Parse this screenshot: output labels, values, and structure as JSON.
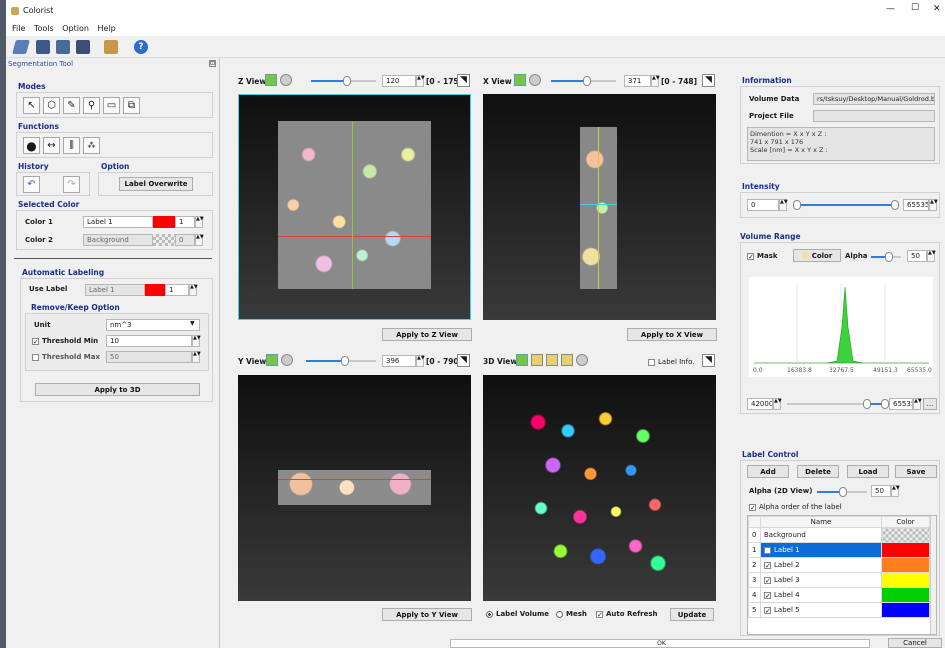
{
  "window": {
    "title": "Colorist",
    "controls": [
      "—",
      "☐",
      "✕"
    ]
  },
  "menu": [
    "File",
    "Tools",
    "Option",
    "Help"
  ],
  "left": {
    "panel_title": "Segmentation Tool",
    "modes_header": "Modes",
    "functions_header": "Functions",
    "history_header": "History",
    "option_header": "Option",
    "label_overwrite": "Label Overwrite",
    "selected_color_header": "Selected Color",
    "color1_label": "Color 1",
    "color1_value": "Label 1",
    "color1_num": "1",
    "color2_label": "Color 2",
    "color2_value": "Background",
    "color2_num": "0",
    "auto_header": "Automatic Labeling",
    "use_label": "Use Label",
    "use_label_value": "Label 1",
    "use_label_num": "1",
    "remove_keep": "Remove/Keep Option",
    "unit_label": "Unit",
    "unit_value": "nm^3",
    "thr_min_label": "Threshold Min",
    "thr_min_value": "10",
    "thr_max_label": "Threshold Max",
    "thr_max_value": "50",
    "apply_3d": "Apply to 3D"
  },
  "views": {
    "z": {
      "title": "Z View",
      "value": "120",
      "range": "[0 - 175]",
      "apply": "Apply to Z View"
    },
    "x": {
      "title": "X View",
      "value": "371",
      "range": "[0 - 748]",
      "apply": "Apply to X View"
    },
    "y": {
      "title": "Y View",
      "value": "396",
      "range": "[0 - 790]",
      "apply": "Apply to Y View"
    },
    "d3": {
      "title": "3D View",
      "label_info": "Label Info.",
      "label_volume": "Label Volume",
      "mesh": "Mesh",
      "auto_refresh": "Auto Refresh",
      "update": "Update"
    }
  },
  "right": {
    "info_header": "Information",
    "volume_data_label": "Volume Data",
    "volume_data_value": "rs/tsksuy/Desktop/Manual/Goldrod.bin",
    "project_file_label": "Project File",
    "info_text1": "Dimention = X x Y x Z :",
    "info_text2": "741 x 791 x 176",
    "info_text3": "Scale [nm] = X x Y x Z :",
    "intensity_header": "Intensity",
    "intensity_min": "0",
    "intensity_max": "65535",
    "volume_range_header": "Volume Range",
    "mask": "Mask",
    "color_btn": "Color",
    "alpha_label": "Alpha",
    "alpha_value": "50",
    "hist_ticks": [
      "0.0",
      "16383.8",
      "32767.5",
      "49151.3",
      "65535.0"
    ],
    "range_min": "42000",
    "range_max": "65535",
    "range_more": "...",
    "label_control_header": "Label Control",
    "add": "Add",
    "delete": "Delete",
    "load": "Load",
    "save": "Save",
    "alpha2d_label": "Alpha (2D View)",
    "alpha2d_value": "50",
    "alpha_order": "Alpha order of the label",
    "col_name": "Name",
    "col_color": "Color"
  },
  "labels": [
    {
      "idx": "0",
      "name": "Background",
      "color": "checker"
    },
    {
      "idx": "1",
      "name": "Label 1",
      "color": "#ff0000"
    },
    {
      "idx": "2",
      "name": "Label 2",
      "color": "#ff7f1f"
    },
    {
      "idx": "3",
      "name": "Label 3",
      "color": "#ffff00"
    },
    {
      "idx": "4",
      "name": "Label 4",
      "color": "#00d000"
    },
    {
      "idx": "5",
      "name": "Label 5",
      "color": "#0000ff"
    }
  ],
  "status": {
    "ok": "OK",
    "cancel": "Cancel"
  }
}
